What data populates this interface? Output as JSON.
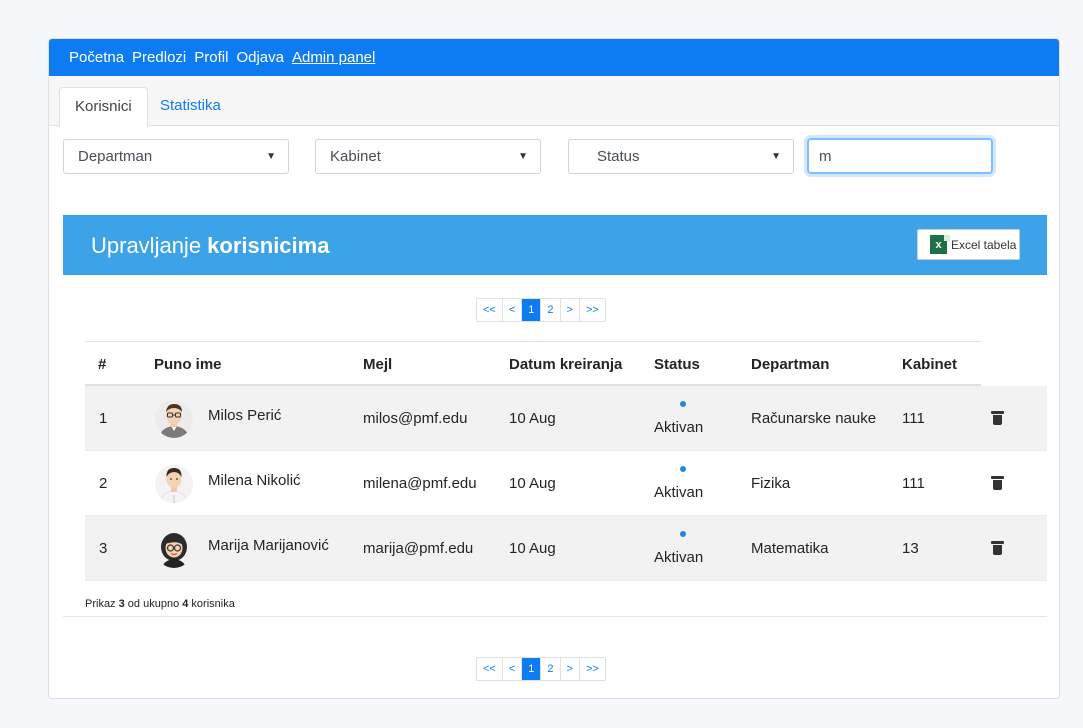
{
  "nav": {
    "items": [
      "Početna",
      "Predlozi",
      "Profil",
      "Odjava"
    ],
    "admin": "Admin panel"
  },
  "tabs": [
    {
      "label": "Korisnici",
      "active": true
    },
    {
      "label": "Statistika",
      "active": false
    }
  ],
  "filters": {
    "department": "Departman",
    "cabinet": "Kabinet",
    "status": "Status",
    "search_value": "m"
  },
  "panel": {
    "title_plain": "Upravljanje ",
    "title_bold": "korisnicima",
    "excel_label": "Excel tabela",
    "excel_icon_letter": "x"
  },
  "pager": {
    "first": "<<",
    "prev": "<",
    "pages": [
      "1",
      "2"
    ],
    "current": "1",
    "next": ">",
    "last": ">>"
  },
  "table": {
    "headers": [
      "#",
      "Puno ime",
      "Mejl",
      "Datum kreiranja",
      "Status",
      "Departman",
      "Kabinet"
    ],
    "rows": [
      {
        "num": "1",
        "name": "Milos Perić",
        "email": "milos@pmf.edu",
        "date": "10 Aug",
        "status": "Aktivan",
        "department": "Računarske nauke",
        "cabinet": "111"
      },
      {
        "num": "2",
        "name": "Milena Nikolić",
        "email": "milena@pmf.edu",
        "date": "10 Aug",
        "status": "Aktivan",
        "department": "Fizika",
        "cabinet": "111"
      },
      {
        "num": "3",
        "name": "Marija Marijanović",
        "email": "marija@pmf.edu",
        "date": "10 Aug",
        "status": "Aktivan",
        "department": "Matematika",
        "cabinet": "13"
      }
    ]
  },
  "summary": {
    "prefix": "Prikaz ",
    "shown": "3",
    "middle": " od ukupno ",
    "total": "4",
    "suffix": " korisnika"
  },
  "colors": {
    "nav_bg": "#0d7cf2",
    "panel_bg": "#3ca3e8",
    "link": "#0d7cf2",
    "status_dot": "#1e88e5",
    "excel_green": "#1e7145"
  },
  "icons": [
    "trash-icon",
    "excel-icon",
    "caret-down-icon",
    "avatar-male-glasses",
    "avatar-male",
    "avatar-female-glasses"
  ]
}
